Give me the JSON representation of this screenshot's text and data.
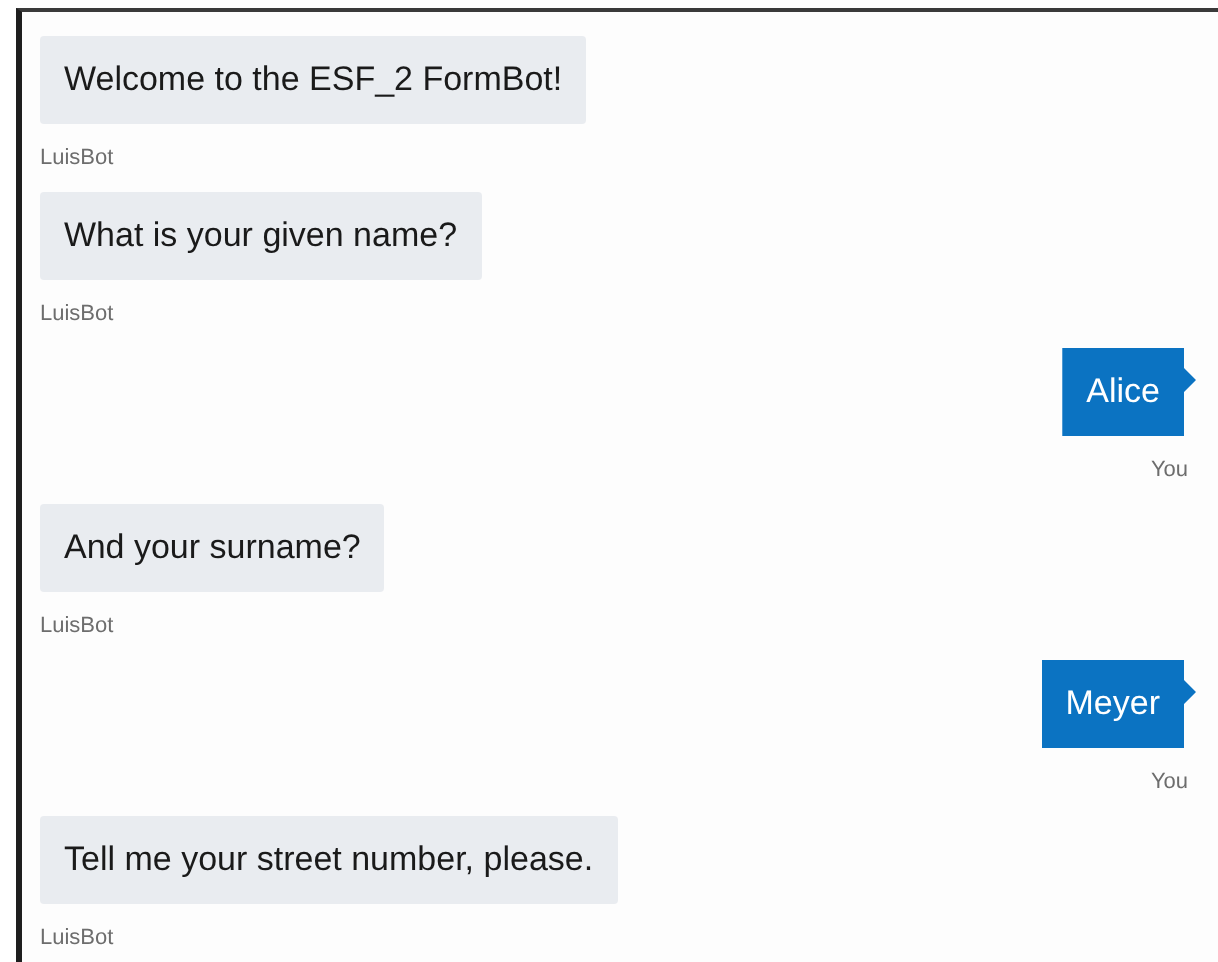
{
  "messages": [
    {
      "kind": "bot",
      "text": "Welcome to the ESF_2 FormBot!",
      "sender": "LuisBot"
    },
    {
      "kind": "bot",
      "text": "What is your given name?",
      "sender": "LuisBot"
    },
    {
      "kind": "user",
      "text": "Alice",
      "sender": "You"
    },
    {
      "kind": "bot",
      "text": "And your surname?",
      "sender": "LuisBot"
    },
    {
      "kind": "user",
      "text": "Meyer",
      "sender": "You"
    },
    {
      "kind": "bot",
      "text": "Tell me your street number, please.",
      "sender": "LuisBot"
    }
  ]
}
